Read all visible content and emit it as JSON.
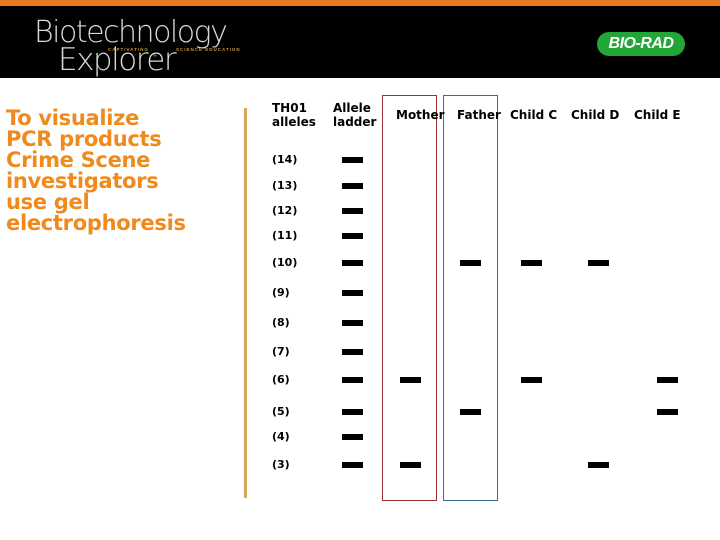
{
  "header": {
    "brand_line1": "Biotechnology",
    "brand_line2": "Explorer",
    "trademark": "™",
    "tagline_part1": "CAPTIVATING",
    "tagline_part2": "SCIENCE EDUCATION",
    "company_logo": "BIO-RAD",
    "accent_color": "#e87722",
    "logo_green": "#21a637"
  },
  "left_panel": {
    "lines": [
      "To visualize",
      "PCR products",
      "Crime Scene",
      "investigators",
      "use gel",
      "electrophoresis"
    ],
    "text_color": "#f08a1c"
  },
  "gel": {
    "row_header": [
      "TH01",
      "alleles"
    ],
    "ladder_header": [
      "Allele",
      "ladder"
    ],
    "lanes": [
      {
        "name": "Mother",
        "alleles": [
          6,
          3
        ],
        "box_color": "#a03030"
      },
      {
        "name": "Father",
        "alleles": [
          10,
          5
        ],
        "box_color": "#3a6e98"
      },
      {
        "name": "Child C",
        "alleles": [
          10,
          6
        ]
      },
      {
        "name": "Child D",
        "alleles": [
          10,
          3
        ]
      },
      {
        "name": "Child E",
        "alleles": [
          6,
          5
        ]
      }
    ],
    "ladder_alleles": [
      14,
      13,
      12,
      11,
      10,
      9,
      8,
      7,
      6,
      5,
      4,
      3
    ],
    "row_labels": [
      "(14)",
      "(13)",
      "(12)",
      "(11)",
      "(10)",
      "(9)",
      "(8)",
      "(7)",
      "(6)",
      "(5)",
      "(4)",
      "(3)"
    ]
  }
}
